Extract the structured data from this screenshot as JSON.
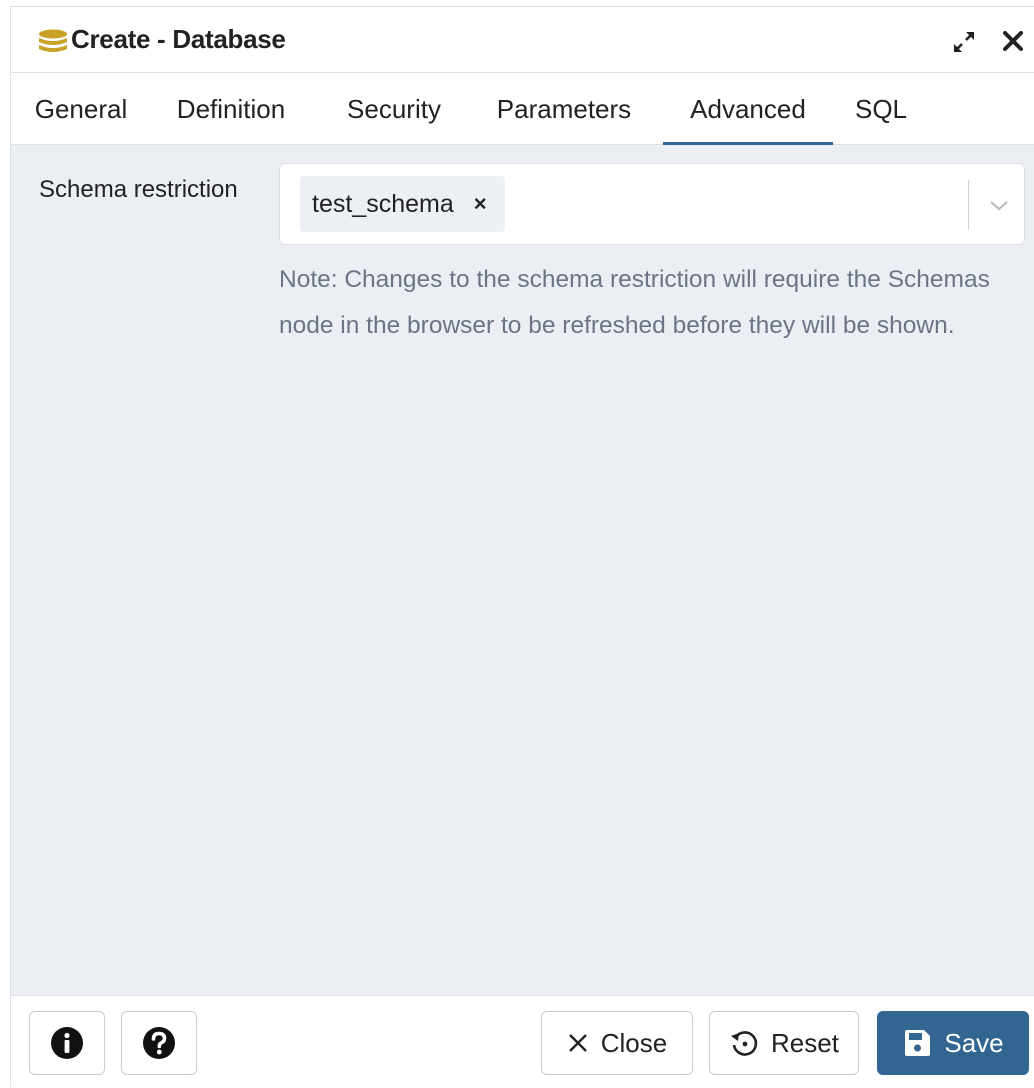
{
  "window": {
    "title": "Create - Database",
    "icon": "database-icon",
    "controls": [
      "expand-icon",
      "close-icon"
    ]
  },
  "tabs": [
    {
      "label": "General",
      "active": false
    },
    {
      "label": "Definition",
      "active": false
    },
    {
      "label": "Security",
      "active": false
    },
    {
      "label": "Parameters",
      "active": false
    },
    {
      "label": "Advanced",
      "active": true
    },
    {
      "label": "SQL",
      "active": false
    }
  ],
  "form": {
    "schema_restriction": {
      "label": "Schema restriction",
      "selected": [
        "test_schema"
      ],
      "note": "Note: Changes to the schema restriction will require the Schemas node in the browser to be refreshed before they will be shown."
    }
  },
  "footer": {
    "info_icon": "info-icon",
    "help_icon": "help-icon",
    "close_label": "Close",
    "reset_label": "Reset",
    "save_label": "Save"
  },
  "colors": {
    "accent": "#326690",
    "content_bg": "#ebeef3",
    "note_text": "#6b7585",
    "db_icon": "#c9a227"
  }
}
